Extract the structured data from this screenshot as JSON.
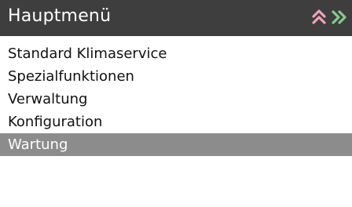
{
  "header": {
    "title": "Hauptmenü",
    "background_color": "#3e3e3e",
    "icons": [
      {
        "name": "double-chevron-up-icon",
        "color": "#f2a1b3"
      },
      {
        "name": "double-chevron-right-icon",
        "color": "#86c98a"
      }
    ]
  },
  "menu": {
    "items": [
      {
        "label": "Standard Klimaservice",
        "selected": false
      },
      {
        "label": "Spezialfunktionen",
        "selected": false
      },
      {
        "label": "Verwaltung",
        "selected": false
      },
      {
        "label": "Konfiguration",
        "selected": false
      },
      {
        "label": "Wartung",
        "selected": true
      }
    ],
    "selected_color": "#8c8c8c"
  }
}
